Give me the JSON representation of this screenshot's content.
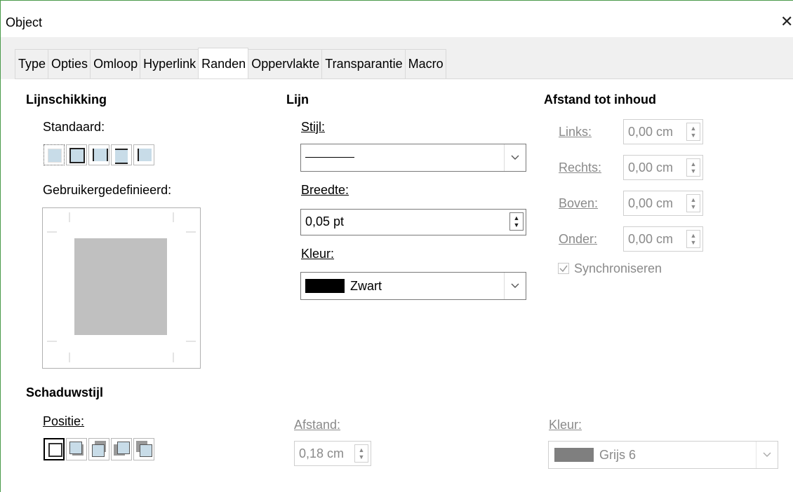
{
  "window": {
    "title": "Object",
    "close_glyph": "✕"
  },
  "tabs": [
    {
      "label": "Type"
    },
    {
      "label": "Opties"
    },
    {
      "label": "Omloop"
    },
    {
      "label": "Hyperlink"
    },
    {
      "label": "Randen",
      "active": true
    },
    {
      "label": "Oppervlakte"
    },
    {
      "label": "Transparantie"
    },
    {
      "label": "Macro"
    }
  ],
  "line_arrangement": {
    "heading": "Lijnschikking",
    "default_label": "Standaard:",
    "user_defined_label": "Gebruikergedefinieerd:"
  },
  "line": {
    "heading": "Lijn",
    "style_label": "Stijl:",
    "width_label": "Breedte:",
    "width_value": "0,05 pt",
    "color_label": "Kleur:",
    "color_value": "Zwart",
    "color_swatch": "#000000"
  },
  "spacing": {
    "heading": "Afstand tot inhoud",
    "left_label": "Links:",
    "left_value": "0,00 cm",
    "right_label": "Rechts:",
    "right_value": "0,00 cm",
    "top_label": "Boven:",
    "top_value": "0,00 cm",
    "bottom_label": "Onder:",
    "bottom_value": "0,00 cm",
    "sync_label": "Synchroniseren",
    "sync_checked": true
  },
  "shadow": {
    "heading": "Schaduwstijl",
    "position_label": "Positie:",
    "distance_label": "Afstand:",
    "distance_value": "0,18 cm",
    "color_label": "Kleur:",
    "color_value": "Grijs 6",
    "color_swatch": "#7f7f7f"
  },
  "colors": {
    "accent_border": "#4a9a4a",
    "preview_fill": "#c0c0c0"
  }
}
